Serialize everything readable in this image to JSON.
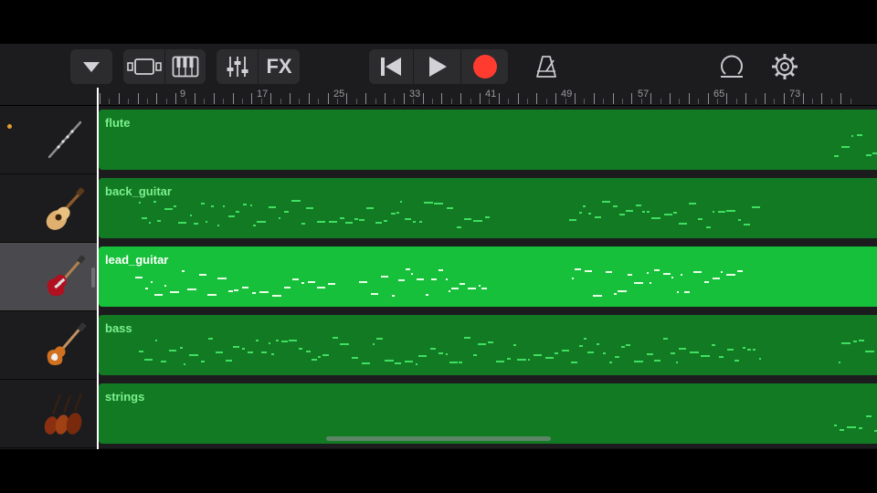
{
  "toolbar": {
    "icons": {
      "tracks_menu": "triangle-down-icon",
      "track_view": "tracks-view-icon",
      "keyboard": "piano-keyboard-icon",
      "mixer": "mixer-sliders-icon",
      "go_to_start": "skip-back-icon",
      "play": "play-icon",
      "record": "record-icon",
      "metronome": "metronome-icon",
      "loop_browser": "loop-icon",
      "settings": "gear-icon"
    },
    "fx_label": "FX",
    "record_color": "#ff3b30"
  },
  "ruler": {
    "labels": [
      "9",
      "17",
      "25",
      "33",
      "41",
      "49",
      "57",
      "65",
      "73"
    ],
    "add_label": "+"
  },
  "tracks": [
    {
      "name": "flute",
      "instrument_icon": "flute-icon",
      "selected": false,
      "armed": true
    },
    {
      "name": "back_guitar",
      "instrument_icon": "acoustic-guitar-icon",
      "selected": false,
      "armed": false
    },
    {
      "name": "lead_guitar",
      "instrument_icon": "electric-guitar-icon",
      "selected": true,
      "armed": false
    },
    {
      "name": "bass",
      "instrument_icon": "bass-guitar-icon",
      "selected": false,
      "armed": false
    },
    {
      "name": "strings",
      "instrument_icon": "violin-section-icon",
      "selected": false,
      "armed": false
    }
  ],
  "colors": {
    "region": "#137a24",
    "region_selected": "#17c03a",
    "note": "#3fe060",
    "note_selected": "#e8ffe8"
  }
}
